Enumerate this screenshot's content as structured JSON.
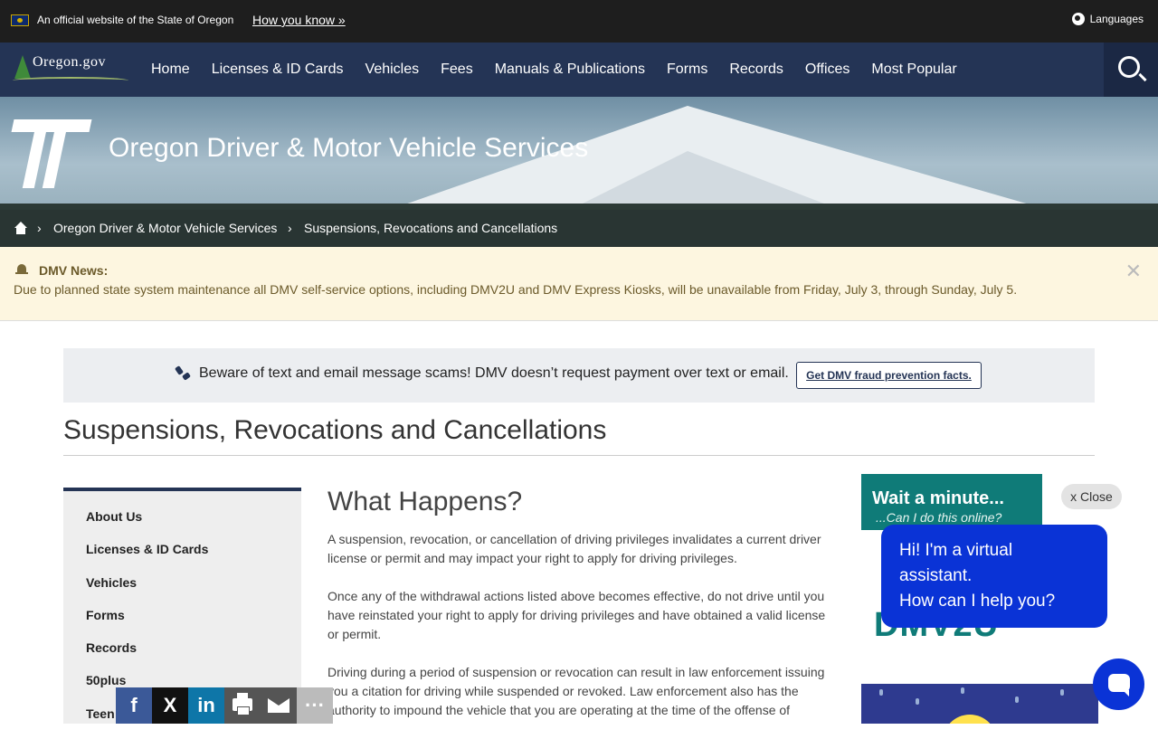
{
  "official_bar": {
    "text": "An official website of the State of Oregon",
    "how_link": "How you know »",
    "languages": "Languages"
  },
  "nav": {
    "logo_text": "Oregon.gov",
    "items": [
      "Home",
      "Licenses & ID Cards",
      "Vehicles",
      "Fees",
      "Manuals & Publications",
      "Forms",
      "Records",
      "Offices",
      "Most Popular"
    ]
  },
  "hero": {
    "title": "Oregon Driver & Motor Vehicle Services",
    "breadcrumb": [
      "Oregon Driver & Motor Vehicle Services",
      "Suspensions, Revocations and Cancellations"
    ]
  },
  "news": {
    "label": "DMV News:",
    "message": "Due to planned state system maintenance all DMV self-service options, including DMV2U and DMV Express Kiosks, will be unavailable from Friday, July 3, through Sunday, July 5.",
    "close": "✕"
  },
  "scam": {
    "text": "Beware of text and email message scams! DMV doesn’t request payment over text or email.",
    "button": "Get DMV fraud prevention facts."
  },
  "page_title": "Suspensions, Revocations and Cancellations",
  "side_menu": [
    "About Us",
    "Licenses & ID Cards",
    "Vehicles",
    "Forms",
    "Records",
    "50plus",
    "Teen"
  ],
  "content": {
    "heading": "What Happens?",
    "paragraphs": [
      "A suspension, revocation, or cancellation of driving privileges invalidates a current driver license or permit and may impact your right to apply for driving privileges.",
      "Once any of the withdrawal actions listed above becomes effective, do not drive until you have reinstated your right to apply for driving privileges and have obtained a valid license or permit.",
      "Driving during a period of suspension or revocation can result in law enforcement issuing you a citation for driving while suspended or revoked. Law enforcement also has the authority to impound the vehicle that you are operating at the time of the offense of"
    ]
  },
  "ad": {
    "line1": "Wait a minute...",
    "line2": "...Can I do this online?",
    "brand": "DMV2U"
  },
  "chat": {
    "close": "x Close",
    "lines": [
      "Hi! I'm a virtual",
      "assistant.",
      "How can I help you?"
    ]
  },
  "share": {
    "facebook": "f",
    "x": "X",
    "linkedin": "in",
    "more": "···"
  },
  "colors": {
    "nav": "#243455",
    "chat": "#0a33d6",
    "news_bg": "#fdf6e0",
    "dmv_teal": "#0f7b78"
  }
}
